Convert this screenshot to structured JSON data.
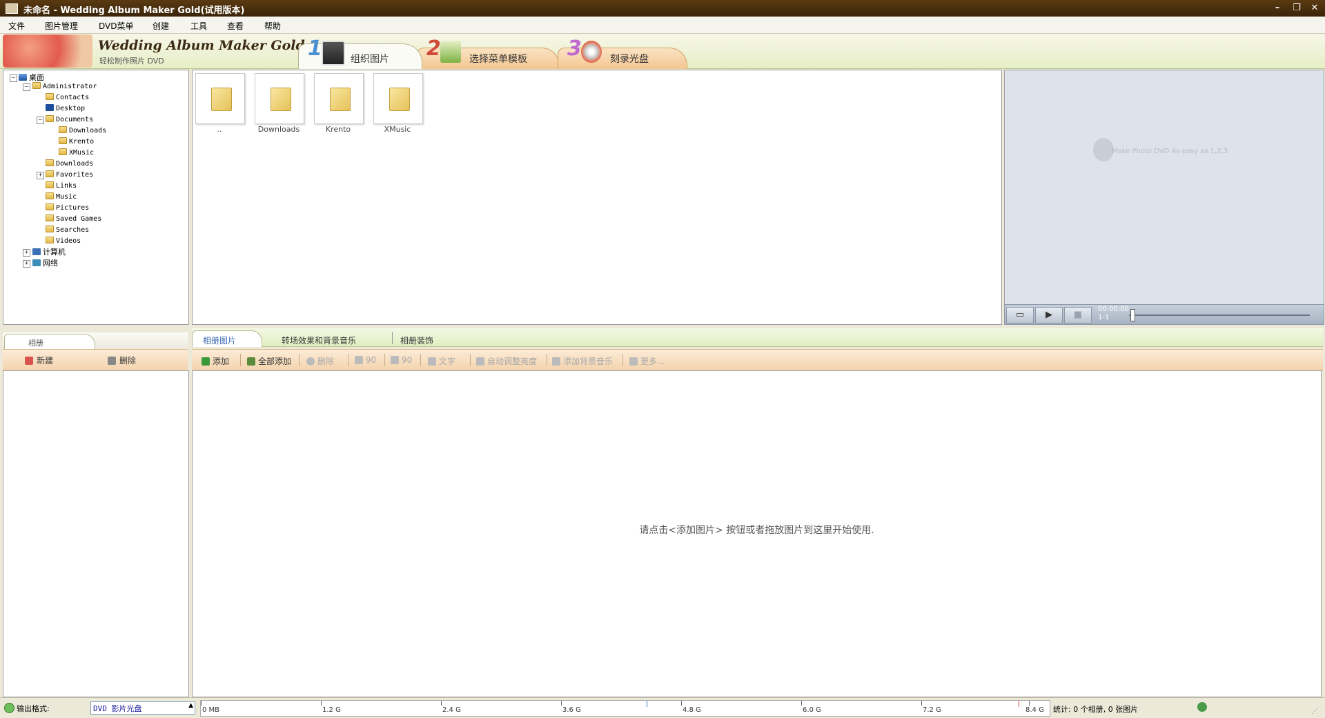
{
  "window": {
    "title": "未命名 - Wedding Album Maker Gold(试用版本)",
    "controls": [
      "–",
      "❐",
      "✕"
    ]
  },
  "menu": [
    "文件",
    "图片管理",
    "DVD菜单",
    "创建",
    "工具",
    "查看",
    "帮助"
  ],
  "banner": {
    "logo_text": "Wedding Album Maker Gold",
    "logo_subtitle": "轻松制作照片 DVD",
    "steps": [
      {
        "num": "1",
        "label": "组织图片",
        "icon": "photo-album-icon"
      },
      {
        "num": "2",
        "label": "选择菜单模板",
        "icon": "checkmark-template-icon"
      },
      {
        "num": "3",
        "label": "刻录光盘",
        "icon": "burn-disc-icon"
      }
    ]
  },
  "tree": {
    "root": "桌面",
    "administrator": "Administrator",
    "contacts": "Contacts",
    "desktop": "Desktop",
    "documents": "Documents",
    "doc_downloads": "Downloads",
    "krento": "Krento",
    "xmusic": "XMusic",
    "downloads": "Downloads",
    "favorites": "Favorites",
    "links": "Links",
    "music": "Music",
    "pictures": "Pictures",
    "saved_games": "Saved Games",
    "searches": "Searches",
    "videos": "Videos",
    "computer": "计算机",
    "network": "网络"
  },
  "files": [
    "..",
    "Downloads",
    "Krento",
    "XMusic"
  ],
  "preview": {
    "watermark": "Make Photo DVD As easy as 1,2,3",
    "timecode": "00:00:00",
    "slide": "1-1"
  },
  "album_panel": {
    "tab": "相册",
    "new": "新建",
    "delete": "删除"
  },
  "content_tabs": [
    "相册图片",
    "转场效果和背景音乐",
    "相册装饰"
  ],
  "toolbar": {
    "add": "添加",
    "add_all": "全部添加",
    "delete": "删除",
    "rotate_left": "90",
    "rotate_right": "90",
    "text": "文字",
    "auto_brightness": "自动调整亮度",
    "add_music": "添加背景音乐",
    "more": "更多..."
  },
  "hint": "请点击<添加图片> 按钮或者拖放图片到这里开始使用.",
  "status": {
    "output_label": "输出格式:",
    "output_value": "DVD 影片光盘",
    "ruler_ticks": [
      "0 MB",
      "1.2 G",
      "2.4 G",
      "3.6 G",
      "4.8 G",
      "6.0 G",
      "7.2 G",
      "8.4 G"
    ],
    "stats": "统计: 0 个相册, 0 张图片"
  },
  "colors": {
    "titlebar": "#4a2f0e",
    "banner_bg": "#e6efc6",
    "toolbar_bg": "#f4d3ad",
    "preview_bg": "#dde3ea"
  }
}
